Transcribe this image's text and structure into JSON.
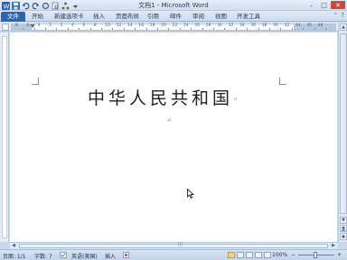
{
  "window": {
    "title": "文档1 - Microsoft Word",
    "controls": {
      "minimize": "–",
      "maximize": "□",
      "close": "✕"
    }
  },
  "qat": {
    "items": [
      "word-icon",
      "save-icon",
      "undo-icon",
      "redo-icon",
      "refresh-icon",
      "print-preview-icon",
      "share-icon",
      "customize-icon"
    ]
  },
  "ribbon": {
    "tabs": [
      "文件",
      "开始",
      "新建选项卡",
      "插入",
      "页面布局",
      "引用",
      "邮件",
      "审阅",
      "视图",
      "开发工具"
    ],
    "right": {
      "minimize": "⌃",
      "help": "?"
    }
  },
  "ruler": {
    "labels": [
      "8",
      "6",
      "4",
      "2",
      "2",
      "4",
      "6",
      "8",
      "10",
      "12",
      "14",
      "16",
      "18",
      "20",
      "22",
      "24",
      "26",
      "28",
      "30",
      "32",
      "34",
      "36",
      "38",
      "40",
      "42",
      "44",
      "46",
      "48"
    ]
  },
  "document": {
    "heading": "中华人民共和国",
    "paragraph_mark": "↵"
  },
  "scroll": {
    "up": "▲",
    "down": "▼",
    "left": "◀",
    "right": "▶",
    "grip": "|||"
  },
  "status": {
    "page": "页面: 1/1",
    "words": "字数: 7",
    "language": "英语(美国)",
    "mode": "插入",
    "zoom": "100%",
    "zoom_out": "−",
    "zoom_in": "+",
    "zoom_level": 100
  },
  "colors": {
    "accent": "#2b64b3",
    "close": "#c9473b",
    "view_active": "#f4d27a"
  }
}
